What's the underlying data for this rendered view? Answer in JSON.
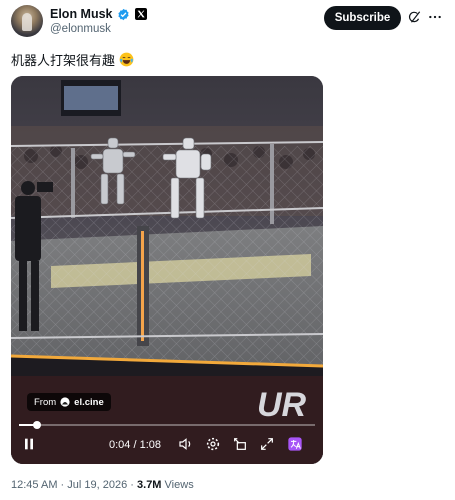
{
  "author": {
    "name": "Elon Musk",
    "handle": "@elonmusk",
    "verified": true,
    "affiliate_badge": "x-logo-icon"
  },
  "actions": {
    "subscribe_label": "Subscribe",
    "grok_icon": "grok-icon",
    "more_icon": "more-icon"
  },
  "post": {
    "text": "机器人打架很有趣",
    "emoji": "face-with-tears-of-joy"
  },
  "video": {
    "from_label": "From",
    "source": "el.cine",
    "current_time": "0:04",
    "separator": "/",
    "duration": "1:08",
    "progress": 0.06
  },
  "meta": {
    "time": "12:45 AM",
    "date": "Jul 19, 2026",
    "dot": "·",
    "views_count": "3.7M",
    "views_label": "Views"
  },
  "colors": {
    "text": "#0f1419",
    "secondary": "#536471",
    "verified": "#1d9bf0",
    "ring_light": "#f2a93b"
  }
}
